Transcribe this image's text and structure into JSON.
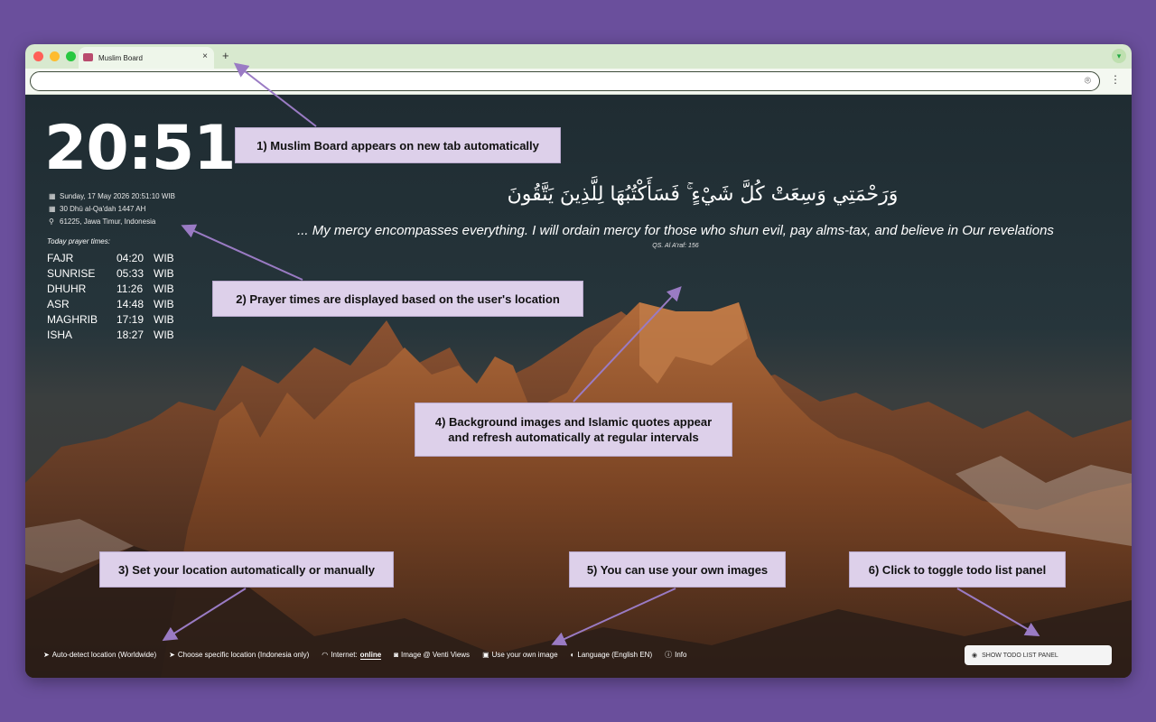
{
  "browser": {
    "tab_title": "Muslim Board",
    "tab_close": "×",
    "new_tab": "+",
    "profile_icon": "chevron-down-icon",
    "location_icon": "map-pin-icon",
    "menu_icon": "⋮"
  },
  "board": {
    "clock": "20:51",
    "date_gregorian": "Sunday, 17 May 2026 20:51:10 WIB",
    "date_hijri": "30 Dhū al-Qa'dah 1447 AH",
    "location": "61225, Jawa Timur, Indonesia",
    "prayer_heading": "Today prayer times:",
    "prayers": [
      {
        "name": "FAJR",
        "time": "04:20",
        "tz": "WIB"
      },
      {
        "name": "SUNRISE",
        "time": "05:33",
        "tz": "WIB"
      },
      {
        "name": "DHUHR",
        "time": "11:26",
        "tz": "WIB"
      },
      {
        "name": "ASR",
        "time": "14:48",
        "tz": "WIB"
      },
      {
        "name": "MAGHRIB",
        "time": "17:19",
        "tz": "WIB"
      },
      {
        "name": "ISHA",
        "time": "18:27",
        "tz": "WIB"
      }
    ],
    "quote_arabic": "وَرَحْمَتِي وَسِعَتْ كُلَّ شَيْءٍ ۚ فَسَأَكْتُبُهَا لِلَّذِينَ يَتَّقُونَ",
    "quote_english": "... My mercy encompasses everything. I will ordain mercy for those who shun evil, pay alms-tax, and believe in Our revelations",
    "quote_ref": "QS. Al A'raf: 156"
  },
  "footer": {
    "auto_location": "Auto-detect location (Worldwide)",
    "choose_location": "Choose specific location (Indonesia only)",
    "internet_label": "Internet:",
    "internet_status": "online",
    "image_credit": "Image @ Venti Views",
    "own_image": "Use your own image",
    "language": "Language (English EN)",
    "info": "Info",
    "todo_button": "SHOW TODO LIST PANEL"
  },
  "callouts": {
    "c1": "1) Muslim Board appears on new tab automatically",
    "c2": "2) Prayer times are displayed based on the user's location",
    "c3": "3) Set your location automatically or manually",
    "c4_line1": "4) Background images and Islamic quotes appear",
    "c4_line2": "and refresh automatically at regular intervals",
    "c5": "5) You can use your own images",
    "c6": "6) Click to toggle todo list panel"
  },
  "colors": {
    "page_bg": "#6a4f9c",
    "callout_bg": "#ddd0ea",
    "arrow": "#9a7bc4"
  }
}
